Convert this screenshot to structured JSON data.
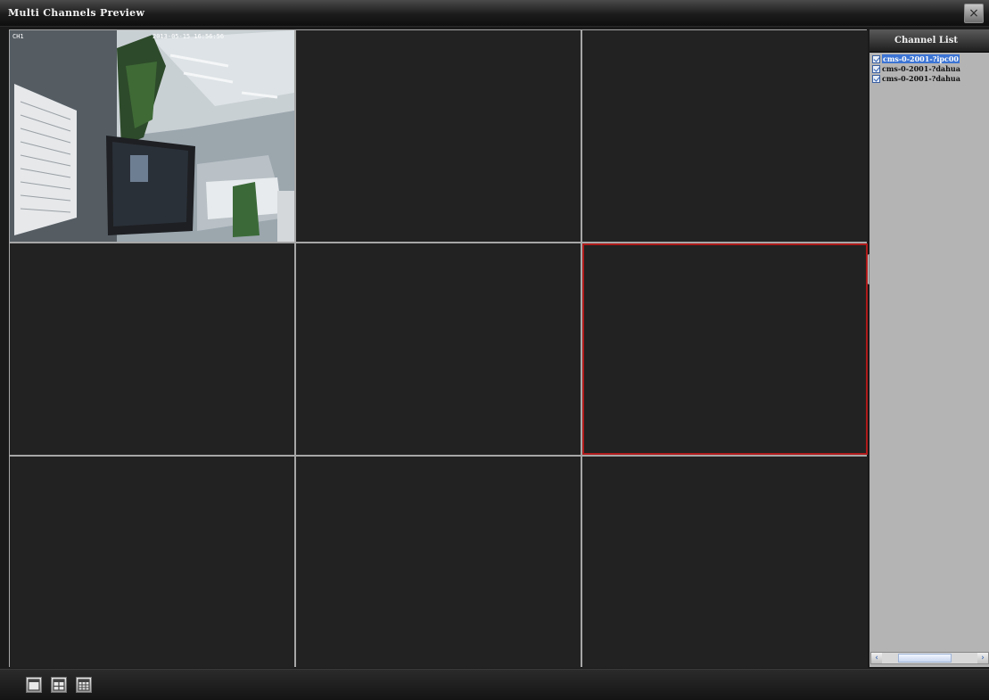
{
  "window": {
    "title": "Multi Channels Preview",
    "close_icon": "×"
  },
  "preview": {
    "grid": "3x3",
    "selected_cell": 6,
    "selected_color": "#b01b1b",
    "cells": [
      {
        "label": "CH1",
        "timestamp": "2013-05-15 16:56:56",
        "has_video": true
      },
      {
        "label": "",
        "timestamp": "",
        "has_video": false
      },
      {
        "label": "",
        "timestamp": "",
        "has_video": false
      },
      {
        "label": "",
        "timestamp": "",
        "has_video": false
      },
      {
        "label": "",
        "timestamp": "",
        "has_video": false
      },
      {
        "label": "",
        "timestamp": "",
        "has_video": false
      },
      {
        "label": "",
        "timestamp": "",
        "has_video": false
      },
      {
        "label": "",
        "timestamp": "",
        "has_video": false
      },
      {
        "label": "",
        "timestamp": "",
        "has_video": false
      }
    ]
  },
  "channel_panel": {
    "header": "Channel List",
    "items": [
      {
        "label": "cms-0-2001-?ipc00",
        "checked": true,
        "active": true
      },
      {
        "label": "cms-0-2001-?dahua",
        "checked": true,
        "active": false
      },
      {
        "label": "cms-0-2001-?dahua",
        "checked": true,
        "active": false
      }
    ],
    "scroll_left_icon": "‹",
    "scroll_right_icon": "›"
  },
  "bottom": {
    "layout_buttons": [
      {
        "icon": "single-view-icon"
      },
      {
        "icon": "quad-view-icon"
      },
      {
        "icon": "nine-view-icon"
      }
    ]
  }
}
